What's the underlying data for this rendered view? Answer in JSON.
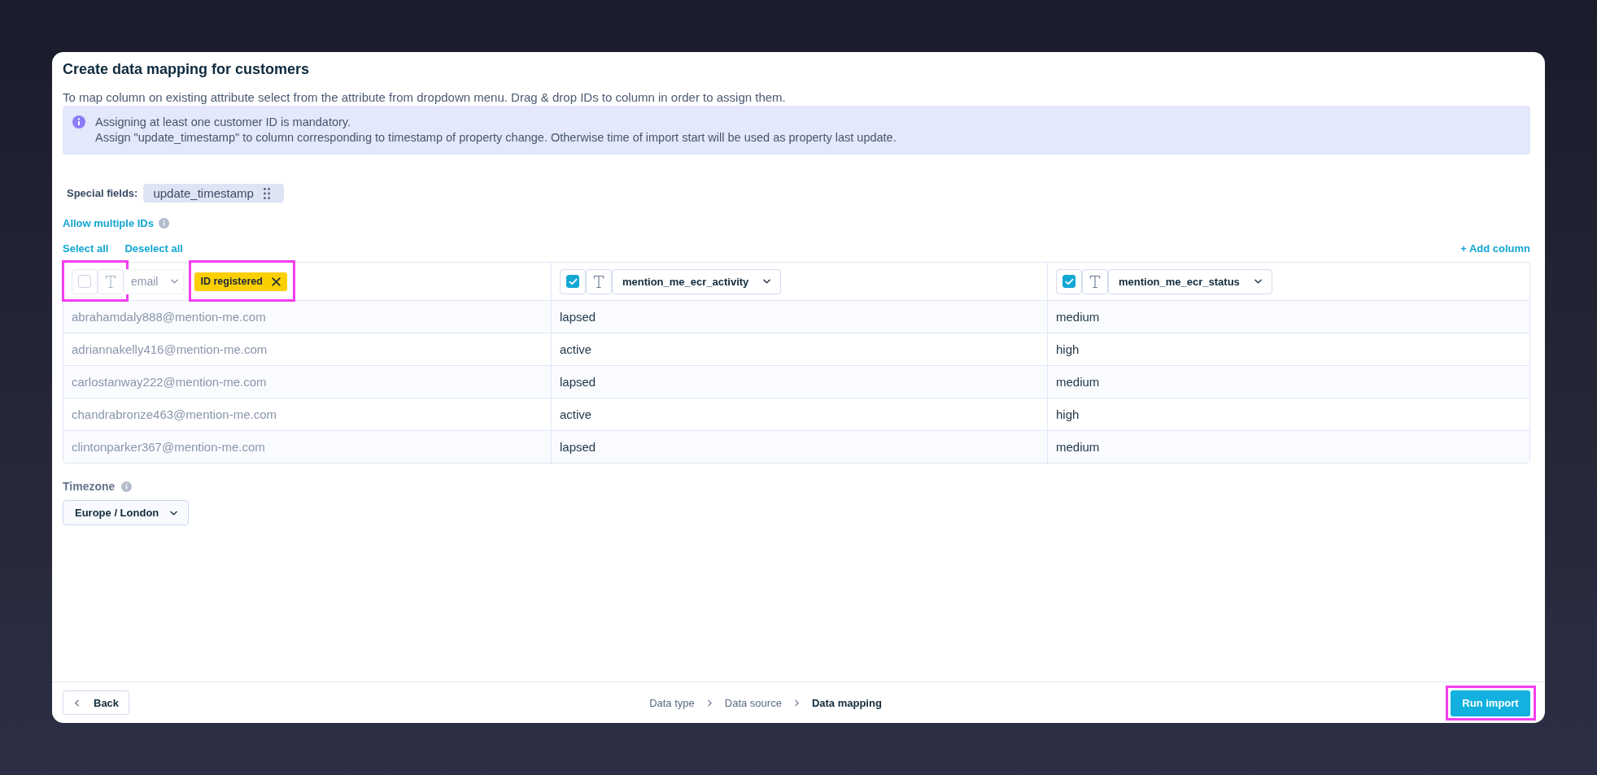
{
  "dialog": {
    "title": "Create data mapping for customers",
    "description": "To map column on existing attribute select from the attribute from dropdown menu. Drag & drop IDs to column in order to assign them."
  },
  "info_box": {
    "lines": [
      "Assigning at least one customer ID is mandatory.",
      "Assign \"update_timestamp\" to column corresponding to timestamp of property change. Otherwise time of import start will be used as property last update."
    ]
  },
  "special_fields": {
    "label": "Special fields:",
    "chips": [
      "update_timestamp"
    ]
  },
  "allow_multiple_ids": {
    "label": "Allow multiple IDs"
  },
  "selection_links": [
    "Select all",
    "Deselect all"
  ],
  "add_column": {
    "label": "+ Add column"
  },
  "table": {
    "columns": [
      {
        "checked": false,
        "controls_highlighted": true,
        "attribute": "email",
        "id_tag": {
          "label": "ID registered",
          "highlighted": true
        }
      },
      {
        "checked": true,
        "controls_highlighted": false,
        "attribute": "mention_me_ecr_activity"
      },
      {
        "checked": true,
        "controls_highlighted": false,
        "attribute": "mention_me_ecr_status"
      }
    ],
    "rows": [
      [
        "abrahamdaly888@mention-me.com",
        "lapsed",
        "medium"
      ],
      [
        "adriannakelly416@mention-me.com",
        "active",
        "high"
      ],
      [
        "carlostanway222@mention-me.com",
        "lapsed",
        "medium"
      ],
      [
        "chandrabronze463@mention-me.com",
        "active",
        "high"
      ],
      [
        "clintonparker367@mention-me.com",
        "lapsed",
        "medium"
      ]
    ]
  },
  "timezone": {
    "label": "Timezone",
    "value": "Europe / London"
  },
  "footer": {
    "back_button": "Back",
    "breadcrumb": [
      {
        "label": "Data type",
        "selected": false
      },
      {
        "label": "Data source",
        "selected": false
      },
      {
        "label": "Data mapping",
        "selected": true
      }
    ],
    "run_import": {
      "label": "Run import",
      "highlighted": true
    }
  }
}
